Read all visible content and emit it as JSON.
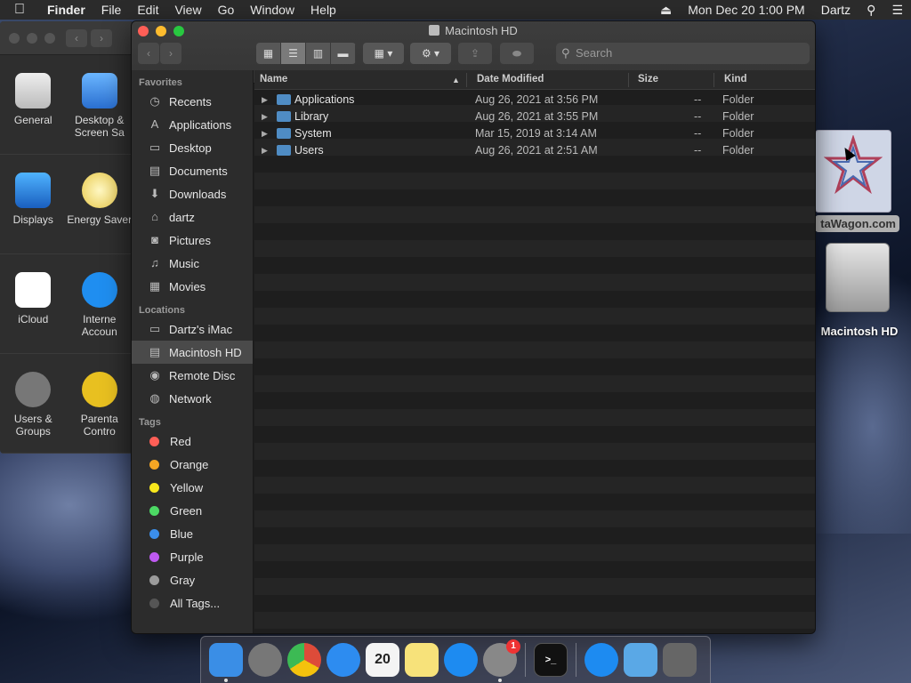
{
  "menubar": {
    "apple_icon": "apple-logo-icon",
    "app_name": "Finder",
    "items": [
      "File",
      "Edit",
      "View",
      "Go",
      "Window",
      "Help"
    ],
    "eject_icon": "eject-icon",
    "datetime": "Mon Dec 20  1:00 PM",
    "user": "Dartz",
    "search_icon": "spotlight-icon",
    "control_icon": "notification-center-icon"
  },
  "syspref": {
    "rows": [
      [
        {
          "label": "General"
        },
        {
          "label": "Desktop & Screen Sa"
        }
      ],
      [
        {
          "label": "Displays"
        },
        {
          "label": "Energy Saver"
        }
      ],
      [
        {
          "label": "iCloud"
        },
        {
          "label": "Interne Accoun"
        }
      ],
      [
        {
          "label": "Users & Groups"
        },
        {
          "label": "Parenta Contro"
        }
      ]
    ]
  },
  "finder": {
    "title": "Macintosh HD",
    "search_placeholder": "Search",
    "toolbar": {
      "back": "‹",
      "forward": "›",
      "view_icon": "▦",
      "view_list": "☰",
      "view_columns": "▥",
      "view_gallery": "▬",
      "group": "▦ ▾",
      "action": "⚙ ▾",
      "share": "⇪",
      "tag": "⬬"
    },
    "sidebar": {
      "favorites_heading": "Favorites",
      "favorites": [
        {
          "label": "Recents",
          "icon": "clock-icon",
          "glyph": "◷"
        },
        {
          "label": "Applications",
          "icon": "applications-icon",
          "glyph": "A"
        },
        {
          "label": "Desktop",
          "icon": "desktop-icon",
          "glyph": "▭"
        },
        {
          "label": "Documents",
          "icon": "documents-icon",
          "glyph": "▤"
        },
        {
          "label": "Downloads",
          "icon": "downloads-icon",
          "glyph": "⬇"
        },
        {
          "label": "dartz",
          "icon": "home-icon",
          "glyph": "⌂"
        },
        {
          "label": "Pictures",
          "icon": "camera-icon",
          "glyph": "◙"
        },
        {
          "label": "Music",
          "icon": "music-icon",
          "glyph": "♫"
        },
        {
          "label": "Movies",
          "icon": "film-icon",
          "glyph": "▦"
        }
      ],
      "locations_heading": "Locations",
      "locations": [
        {
          "label": "Dartz's iMac",
          "icon": "imac-icon",
          "glyph": "▭"
        },
        {
          "label": "Macintosh HD",
          "icon": "hard-drive-icon",
          "glyph": "▤"
        },
        {
          "label": "Remote Disc",
          "icon": "disc-icon",
          "glyph": "◉"
        },
        {
          "label": "Network",
          "icon": "network-globe-icon",
          "glyph": "◍"
        }
      ],
      "tags_heading": "Tags",
      "tags": [
        {
          "label": "Red",
          "color": "#ff5f57"
        },
        {
          "label": "Orange",
          "color": "#f5a623"
        },
        {
          "label": "Yellow",
          "color": "#f8e71c"
        },
        {
          "label": "Green",
          "color": "#4cd964"
        },
        {
          "label": "Blue",
          "color": "#3b8eea"
        },
        {
          "label": "Purple",
          "color": "#bf5af2"
        },
        {
          "label": "Gray",
          "color": "#9b9b9b"
        },
        {
          "label": "All Tags...",
          "color": "#555555"
        }
      ]
    },
    "columns": {
      "name": "Name",
      "date": "Date Modified",
      "size": "Size",
      "kind": "Kind"
    },
    "files": [
      {
        "name": "Applications",
        "date": "Aug 26, 2021 at 3:56 PM",
        "size": "--",
        "kind": "Folder"
      },
      {
        "name": "Library",
        "date": "Aug 26, 2021 at 3:55 PM",
        "size": "--",
        "kind": "Folder"
      },
      {
        "name": "System",
        "date": "Mar 15, 2019 at 3:14 AM",
        "size": "--",
        "kind": "Folder"
      },
      {
        "name": "Users",
        "date": "Aug 26, 2021 at 2:51 AM",
        "size": "--",
        "kind": "Folder"
      }
    ]
  },
  "desktop": {
    "datawagon_label": "taWagon.com",
    "hd_label": "Macintosh HD"
  },
  "dock": {
    "apps": [
      {
        "name": "finder",
        "color": "#3a8ee6",
        "running": true,
        "glyph": ""
      },
      {
        "name": "launchpad",
        "color": "#777",
        "running": false,
        "glyph": ""
      },
      {
        "name": "chrome",
        "color": "#dd4b39",
        "running": false,
        "glyph": ""
      },
      {
        "name": "safari",
        "color": "#2d8cf0",
        "running": false,
        "glyph": ""
      },
      {
        "name": "calendar",
        "color": "#f4f4f4",
        "running": false,
        "glyph": "20"
      },
      {
        "name": "notes",
        "color": "#f7e27a",
        "running": false,
        "glyph": ""
      },
      {
        "name": "app-store",
        "color": "#1d8bf1",
        "running": false,
        "glyph": ""
      },
      {
        "name": "system-preferences",
        "color": "#888",
        "running": true,
        "glyph": "",
        "badge": "1"
      },
      {
        "name": "terminal",
        "color": "#111",
        "running": true,
        "glyph": ">_"
      },
      {
        "name": "app-store-2",
        "color": "#1d8bf1",
        "running": false,
        "glyph": ""
      },
      {
        "name": "downloads-folder",
        "color": "#5aa8e6",
        "running": false,
        "glyph": ""
      },
      {
        "name": "trash",
        "color": "#666",
        "running": false,
        "glyph": ""
      }
    ]
  }
}
